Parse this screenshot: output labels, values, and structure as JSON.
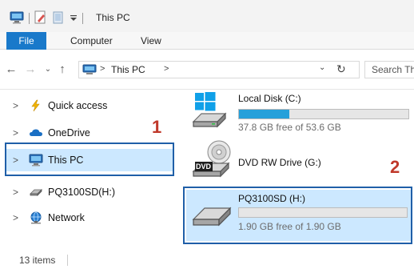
{
  "window": {
    "title": "This PC",
    "accent_color": "#1979ca",
    "selection_color": "#cce8ff",
    "annotation_box_color": "#1f5fa8",
    "annotation_number_color": "#c0392b"
  },
  "quick_access_toolbar": {
    "icons": [
      "computer-icon",
      "properties-icon",
      "new-folder-icon",
      "customize-dropdown-icon"
    ]
  },
  "ribbon": {
    "tabs": [
      {
        "label": "File",
        "active": true
      },
      {
        "label": "Computer",
        "active": false
      },
      {
        "label": "View",
        "active": false
      }
    ]
  },
  "address_bar": {
    "back_glyph": "←",
    "forward_glyph": "→",
    "recent_glyph": "⌄",
    "up_glyph": "↑",
    "path": "This PC",
    "separator_glyph": ">",
    "dropdown_glyph": "⌄",
    "refresh_glyph": "↻",
    "search_placeholder": "Search Th"
  },
  "navigation_pane": {
    "expand_glyph": ">",
    "items": [
      {
        "label": "Quick access",
        "icon": "star-lightning-icon",
        "selected": false
      },
      {
        "label": "OneDrive",
        "icon": "cloud-icon",
        "selected": false
      },
      {
        "label": "This PC",
        "icon": "computer-icon",
        "selected": true
      },
      {
        "label": "PQ3100SD(H:)",
        "icon": "removable-drive-icon",
        "selected": false
      },
      {
        "label": "Network",
        "icon": "network-icon",
        "selected": false
      }
    ]
  },
  "drives": [
    {
      "name": "Local Disk (C:)",
      "icon": "windows-drive-icon",
      "free_text": "37.8 GB free of 53.6 GB",
      "used_fraction": 0.295,
      "selected": false
    },
    {
      "name": "DVD RW Drive (G:)",
      "icon": "dvd-drive-icon",
      "icon_label": "DVD",
      "free_text": "",
      "selected": false
    },
    {
      "name": "PQ3100SD (H:)",
      "icon": "removable-drive-icon",
      "free_text": "1.90 GB free of 1.90 GB",
      "used_fraction": 0.0,
      "selected": true
    }
  ],
  "annotations": [
    {
      "number": "1"
    },
    {
      "number": "2"
    }
  ],
  "status_bar": {
    "item_count": "13 items"
  }
}
